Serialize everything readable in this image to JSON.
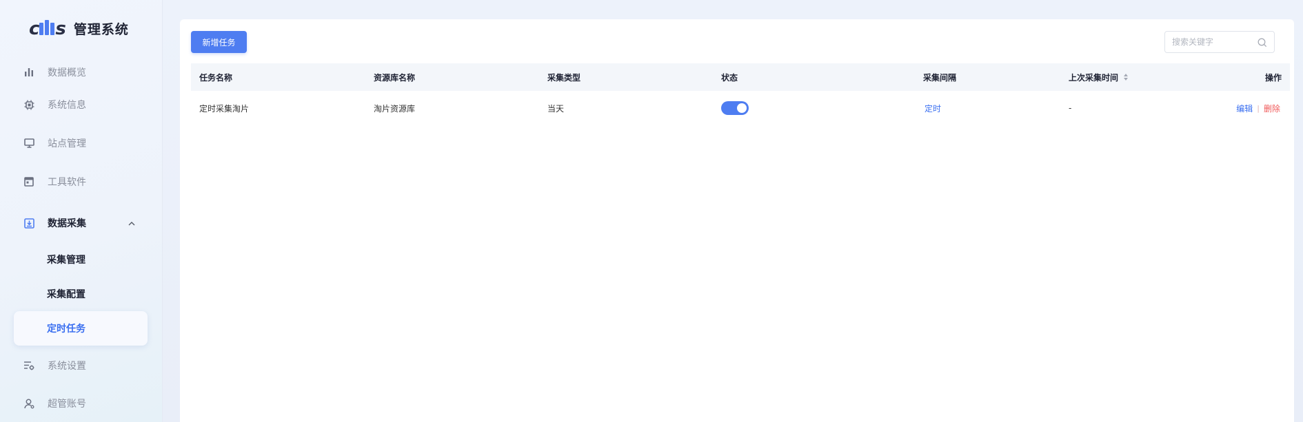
{
  "brand": {
    "logo_alt": "cms",
    "title": "管理系统",
    "accent_color": "#4e7df1"
  },
  "sidebar": {
    "items": [
      {
        "label": "数据概览",
        "icon": "bar-chart-icon"
      },
      {
        "label": "系统信息",
        "icon": "chip-icon"
      },
      {
        "label": "站点管理",
        "icon": "monitor-icon"
      },
      {
        "label": "工具软件",
        "icon": "window-icon"
      },
      {
        "label": "数据采集",
        "icon": "download-box-icon",
        "expanded": true,
        "children": [
          {
            "label": "采集管理"
          },
          {
            "label": "采集配置"
          },
          {
            "label": "定时任务",
            "active": true
          }
        ]
      },
      {
        "label": "系统设置",
        "icon": "settings-list-icon"
      },
      {
        "label": "超管账号",
        "icon": "user-icon"
      }
    ]
  },
  "toolbar": {
    "add_label": "新增任务",
    "search_placeholder": "搜索关键字"
  },
  "table": {
    "columns": [
      "任务名称",
      "资源库名称",
      "采集类型",
      "状态",
      "采集间隔",
      "上次采集时间",
      "操作"
    ],
    "rows": [
      {
        "task_name": "定时采集淘片",
        "resource_name": "淘片资源库",
        "collect_type": "当天",
        "status_on": true,
        "interval": "定时",
        "last_time": "-",
        "actions": {
          "edit": "编辑",
          "separator": "|",
          "delete": "删除"
        }
      }
    ]
  },
  "colors": {
    "primary": "#4e7df1",
    "danger": "#f05a5a",
    "header_bg": "#f3f6fa"
  }
}
